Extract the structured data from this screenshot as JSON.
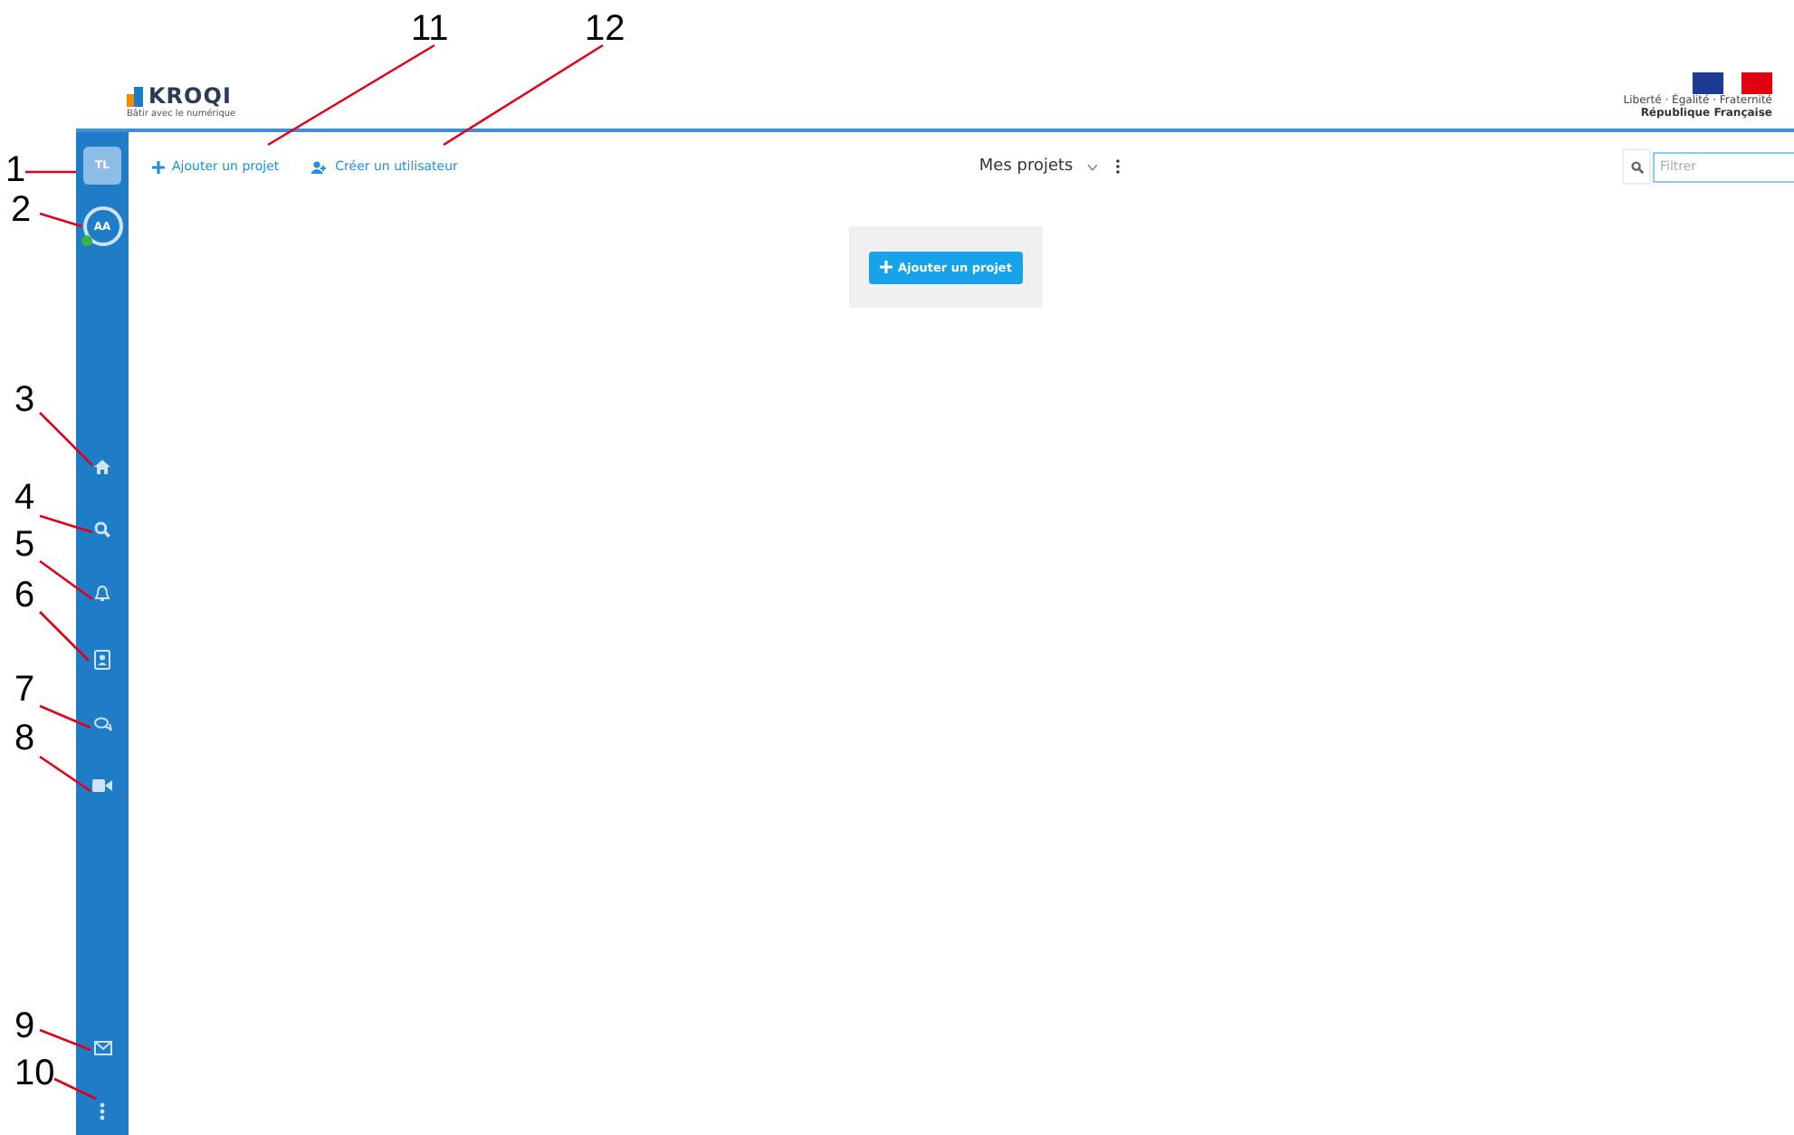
{
  "header": {
    "logo_name": "KROQI",
    "logo_tagline": "Bâtir avec le numérique",
    "emblem_motto": "Liberté · Égalité · Fraternité",
    "emblem_name": "République Française"
  },
  "sidebar": {
    "user_badge": "TL",
    "avatar": "AA",
    "online": true
  },
  "toolbar": {
    "add_project": "Ajouter un projet",
    "create_user": "Créer un utilisateur",
    "view": "Mes projets",
    "filter": {
      "placeholder": "Filtrer"
    }
  },
  "empty_state": {
    "button": "Ajouter un projet"
  },
  "annotations": [
    {
      "label": "1"
    },
    {
      "label": "2"
    },
    {
      "label": "3"
    },
    {
      "label": "4"
    },
    {
      "label": "5"
    },
    {
      "label": "6"
    },
    {
      "label": "7"
    },
    {
      "label": "8"
    },
    {
      "label": "9"
    },
    {
      "label": "10"
    },
    {
      "label": "11"
    },
    {
      "label": "12"
    }
  ]
}
